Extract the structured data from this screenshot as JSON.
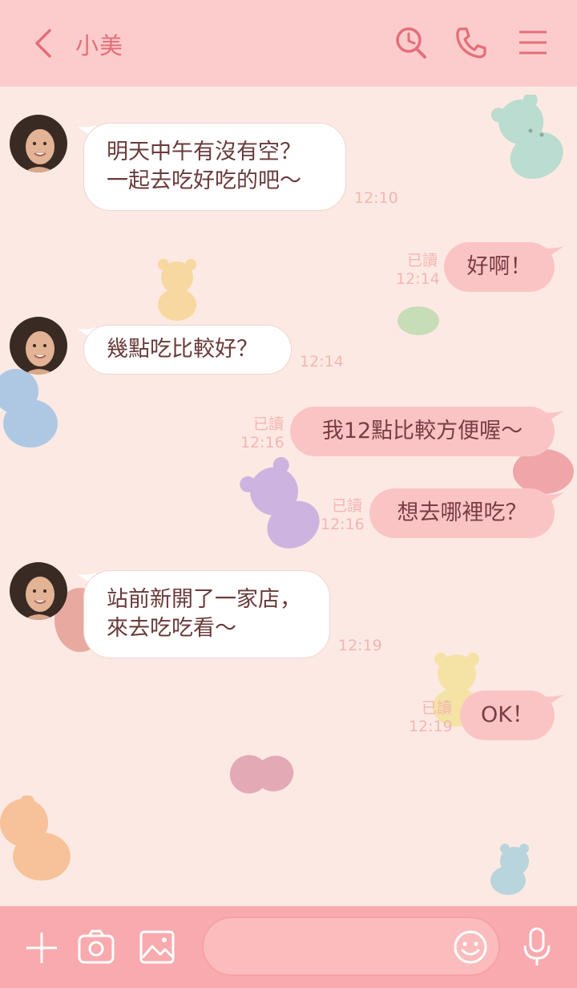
{
  "header": {
    "back_icon": "chevron-left-icon",
    "title": "小美",
    "icons": [
      "search-clock-icon",
      "phone-icon",
      "menu-icon"
    ],
    "accent": "#e46e78",
    "bg": "#fccccc"
  },
  "messages": [
    {
      "side": "in",
      "lines": [
        "明天中午有沒有空？",
        "一起去吃好吃的吧～"
      ],
      "time": "12:10"
    },
    {
      "side": "out",
      "text": "好啊！",
      "read": "已讀",
      "time": "12:14"
    },
    {
      "side": "in",
      "lines": [
        "幾點吃比較好？"
      ],
      "time": "12:14"
    },
    {
      "side": "out",
      "text": "我12點比較方便喔～",
      "read": "已讀",
      "time": "12:16"
    },
    {
      "side": "out",
      "text": "想去哪裡吃？",
      "read": "已讀",
      "time": "12:16"
    },
    {
      "side": "in",
      "lines": [
        "站前新開了一家店，",
        "來去吃吃看～"
      ],
      "time": "12:19"
    },
    {
      "side": "out",
      "text": "OK！",
      "read": "已讀",
      "time": "12:19"
    }
  ],
  "footer": {
    "icons": [
      "plus-icon",
      "camera-icon",
      "image-icon",
      "emoji-icon",
      "microphone-icon"
    ],
    "input_placeholder": ""
  },
  "colors": {
    "chat_bg": "#fde9e3",
    "bubble_out": "#fbc4c4",
    "bubble_in": "#ffffff",
    "footer_bg": "#f9aaae"
  }
}
